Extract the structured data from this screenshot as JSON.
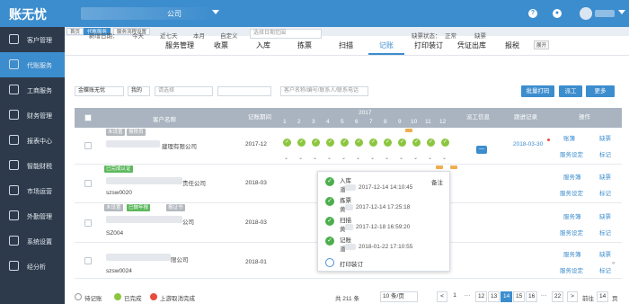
{
  "app": {
    "logo": "账无忧",
    "company_suffix": "公司"
  },
  "sidebar": {
    "items": [
      {
        "label": "客户管理",
        "icon": "person-card-icon"
      },
      {
        "label": "代账服务",
        "icon": "pencil-icon"
      },
      {
        "label": "工商服务",
        "icon": "business-icon"
      },
      {
        "label": "财务管理",
        "icon": "finance-icon"
      },
      {
        "label": "报表中心",
        "icon": "report-icon"
      },
      {
        "label": "智能财税",
        "icon": "smart-tax-icon"
      },
      {
        "label": "市场运营",
        "icon": "market-icon"
      },
      {
        "label": "外勤管理",
        "icon": "field-icon"
      },
      {
        "label": "系统设置",
        "icon": "gear-icon"
      },
      {
        "label": "经分析",
        "icon": "analysis-icon"
      }
    ]
  },
  "page_tabs": [
    "首页",
    "代账服务",
    "服务流程设置"
  ],
  "menu": [
    "服务管理",
    "收票",
    "入库",
    "拣票",
    "扫描",
    "记账",
    "打印装订",
    "凭证出库",
    "报税"
  ],
  "filter": {
    "new_date_label": "新增日期：",
    "today": "今天",
    "last7": "近七天",
    "month": "本月",
    "custom": "自定义",
    "date_placeholder": "选择日期范围",
    "missing_label": "缺票状态：",
    "normal": "正常",
    "missing": "缺票"
  },
  "filter2": {
    "combo": "金蝶账无忧",
    "mine": "我的",
    "select_placeholder": "请选择",
    "search_placeholder": "客户名称/编号/联系人/联系电话",
    "print_btn": "批量打码",
    "assign_btn": "派工",
    "more_btn": "更多",
    "expand": "展开"
  },
  "table": {
    "headers": {
      "name": "客户名称",
      "period": "记账期间",
      "year": "2017",
      "dispatch": "派工信息",
      "records": "跟进记录",
      "actions": "操作"
    },
    "months": [
      "1",
      "2",
      "3",
      "4",
      "5",
      "6",
      "7",
      "8",
      "9",
      "10",
      "11",
      "12"
    ],
    "rows": [
      {
        "tags": [
          "未设置",
          "报税员"
        ],
        "name": "建理有限公司",
        "period": "2017-12",
        "record": "2018-03-30",
        "a1": "账簿",
        "a2": "缺票",
        "a3": "服务设定",
        "a4": "标记"
      },
      {
        "tags": [
          "已完成认证"
        ],
        "name": "责任公司",
        "code": "szsw0020",
        "period": "2018-03",
        "a1": "服务簿",
        "a2": "缺票",
        "a3": "服务设定",
        "a4": "标记"
      },
      {
        "tags": [
          "未设置",
          "已做年报",
          "报证书"
        ],
        "name": "公司",
        "code": "SZ004",
        "period": "2018-03",
        "a1": "服务簿",
        "a2": "缺票",
        "a3": "服务设定",
        "a4": "标记"
      },
      {
        "tags": [],
        "name": "限公司",
        "code": "szsw0024",
        "period": "2018-01",
        "a1": "服务簿",
        "a2": "缺票",
        "a3": "服务设定",
        "a4": "标记"
      }
    ]
  },
  "popover": {
    "note_label": "备注",
    "steps": [
      {
        "title": "入库",
        "user": "潘",
        "time": "2017-12-14 14:10:45",
        "done": true
      },
      {
        "title": "拣票",
        "user": "黄",
        "time": "2017-12-14 17:25:18",
        "done": true
      },
      {
        "title": "扫描",
        "user": "黄",
        "time": "2017-12-18 16:59:20",
        "done": true
      },
      {
        "title": "记账",
        "user": "潘",
        "time": "2018-01-22 17:10:55",
        "done": true
      },
      {
        "title": "打印装订",
        "user": "",
        "time": "",
        "done": false
      }
    ]
  },
  "footer": {
    "legend": [
      "待记账",
      "已完成",
      "上游取消完成"
    ],
    "total": "共 211 条",
    "page_size": "10 条/页",
    "pages": [
      "<",
      "1",
      "···",
      "12",
      "13",
      "14",
      "15",
      "16",
      "···",
      "22",
      ">"
    ],
    "goto": "前往",
    "goto_page": "14",
    "page_unit": "页"
  },
  "colors": {
    "primary": "#3c8dce",
    "sidebar": "#2d3a4b",
    "done": "#8cc63f",
    "warn": "#f0ad4e",
    "danger": "#e74c3c"
  }
}
